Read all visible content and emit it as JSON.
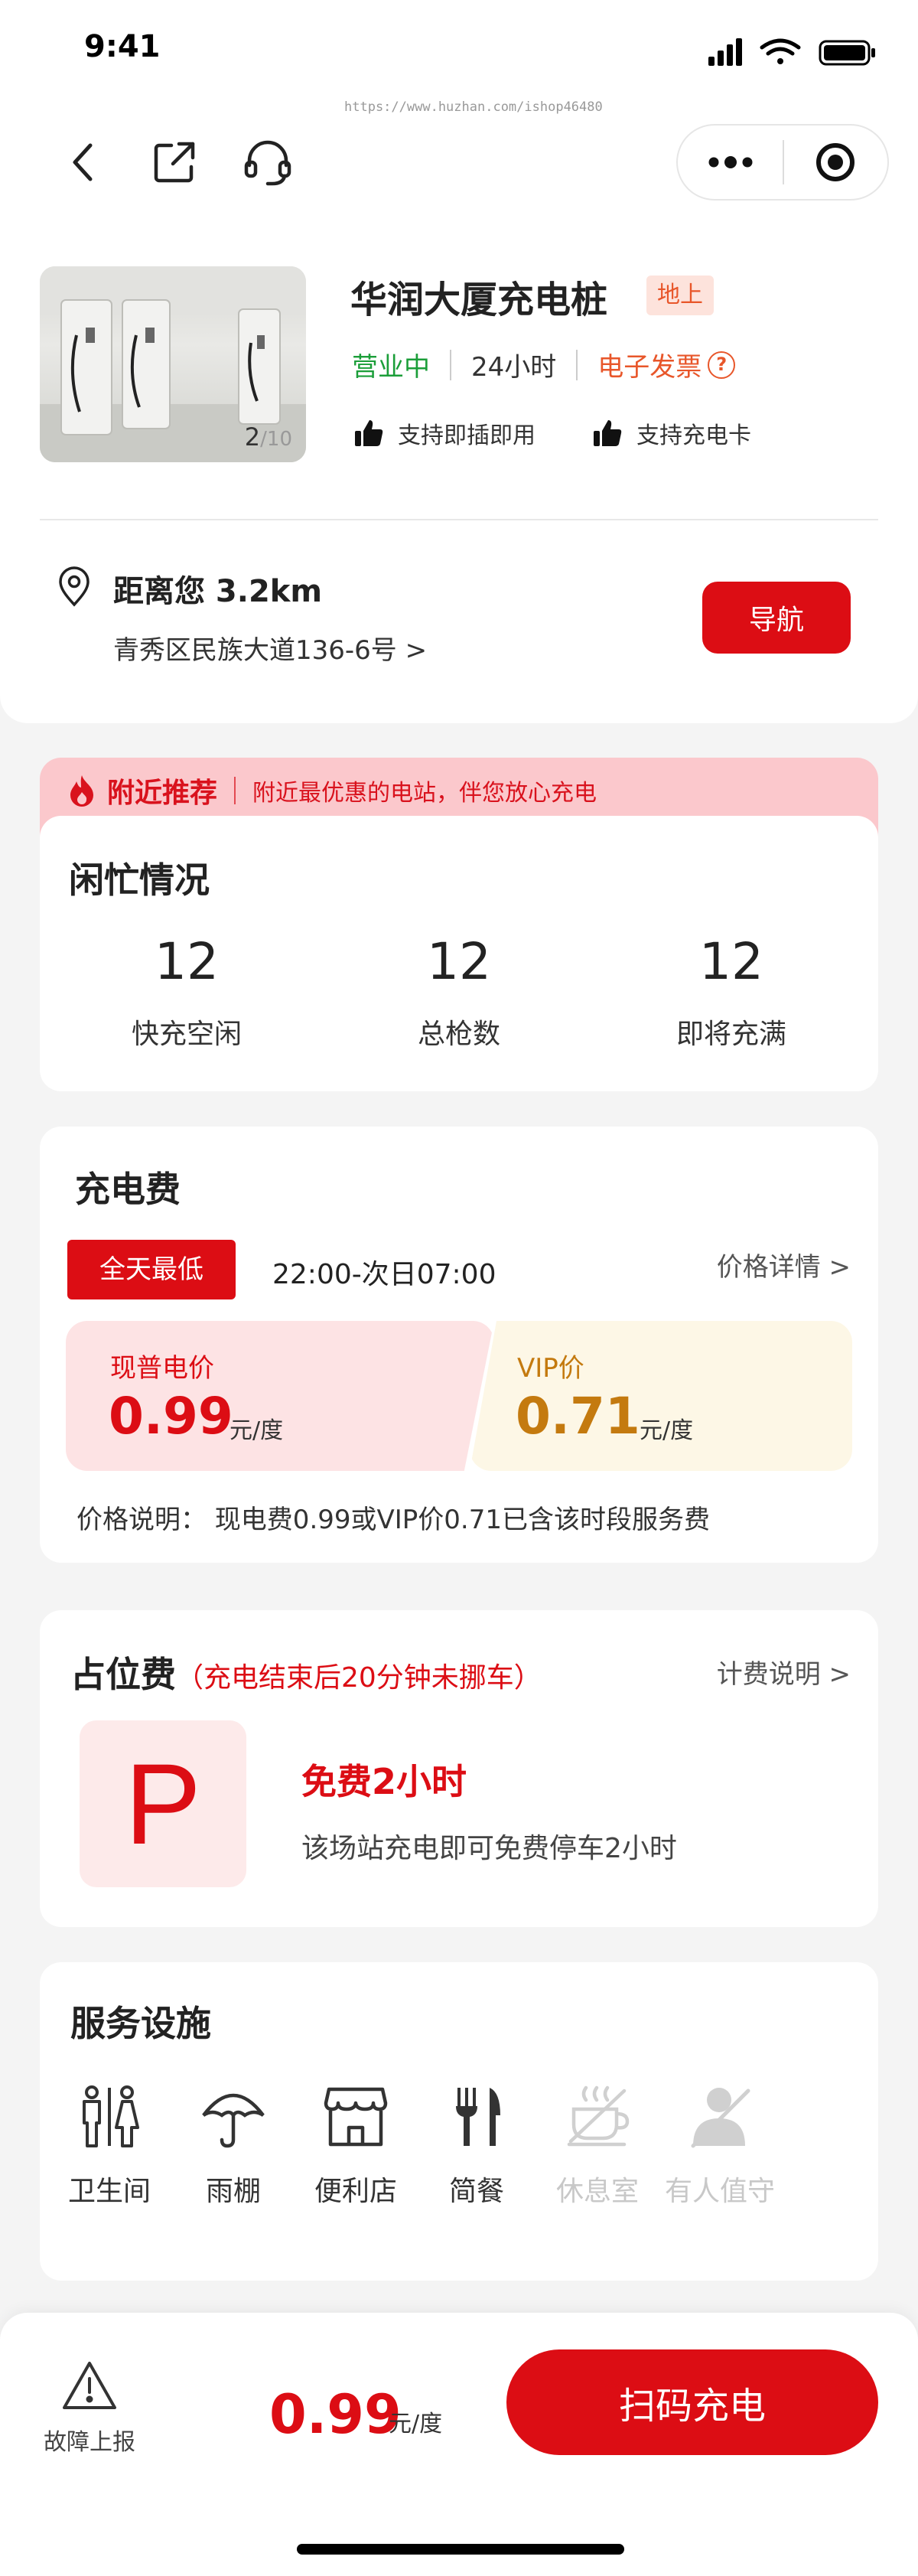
{
  "status_bar": {
    "time": "9:41"
  },
  "watermark": "https://www.huzhan.com/ishop46480",
  "station": {
    "name": "华润大厦充电桩",
    "tag": "地上",
    "status": "营业中",
    "hours": "24小时",
    "invoice": "电子发票",
    "features": [
      "支持即插即用",
      "支持充电卡"
    ],
    "image_counter_current": "2",
    "image_counter_total": "/10",
    "distance": "距离您 3.2km",
    "address": "青秀区民族大道136-6号 >",
    "nav_label": "导航"
  },
  "banner": {
    "title": "附近推荐",
    "desc": "附近最优惠的电站，伴您放心充电"
  },
  "busy": {
    "title": "闲忙情况",
    "stats": [
      {
        "value": "12",
        "label": "快充空闲"
      },
      {
        "value": "12",
        "label": "总枪数"
      },
      {
        "value": "12",
        "label": "即将充满"
      }
    ]
  },
  "fee": {
    "title": "充电费",
    "badge": "全天最低",
    "time_range": "22:00-次日07:00",
    "detail_link": "价格详情 >",
    "normal_label": "现普电价",
    "normal_price": "0.99",
    "vip_label": "VIP价",
    "vip_price": "0.71",
    "unit": "元/度",
    "note": "价格说明：  现电费0.99或VIP价0.71已含该时段服务费"
  },
  "parking": {
    "title": "占位费",
    "subtitle": "（充电结束后20分钟未挪车）",
    "detail_link": "计费说明 >",
    "p_letter": "P",
    "free_title": "免费2小时",
    "free_desc": "该场站充电即可免费停车2小时"
  },
  "services": {
    "title": "服务设施",
    "items": [
      {
        "label": "卫生间",
        "icon": "restroom-icon",
        "enabled": true
      },
      {
        "label": "雨棚",
        "icon": "umbrella-icon",
        "enabled": true
      },
      {
        "label": "便利店",
        "icon": "store-icon",
        "enabled": true
      },
      {
        "label": "简餐",
        "icon": "dining-icon",
        "enabled": true
      },
      {
        "label": "休息室",
        "icon": "lounge-icon",
        "enabled": false
      },
      {
        "label": "有人值守",
        "icon": "attendant-icon",
        "enabled": false
      }
    ]
  },
  "bottom_bar": {
    "fault_label": "故障上报",
    "price": "0.99",
    "unit": "元/度",
    "scan_label": "扫码充电"
  },
  "colors": {
    "brand_red": "#dc0d14",
    "open_green": "#1b9e39",
    "orange": "#e8562a",
    "vip_gold": "#c47a0f"
  }
}
